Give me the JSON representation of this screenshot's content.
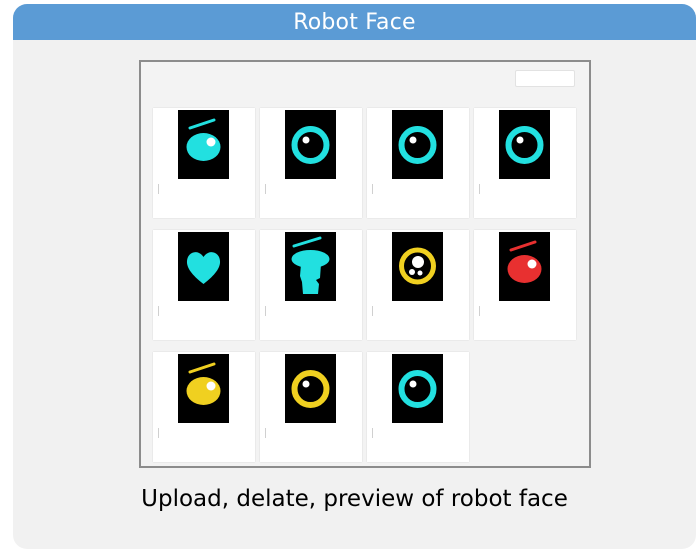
{
  "header": {
    "title": "Robot Face"
  },
  "panel": {
    "top_button_label": ""
  },
  "tile_actions": {
    "edit_label": "",
    "delete_label": ""
  },
  "faces": [
    {
      "icon": "cyan-tilted-eye-with-brow-icon",
      "color": "#22e0e0"
    },
    {
      "icon": "cyan-ring-eye-icon",
      "color": "#22e0e0"
    },
    {
      "icon": "cyan-ring-eye-icon",
      "color": "#22e0e0"
    },
    {
      "icon": "cyan-ring-eye-icon",
      "color": "#22e0e0"
    },
    {
      "icon": "cyan-heart-icon",
      "color": "#22e0e0"
    },
    {
      "icon": "cyan-mushroom-face-icon",
      "color": "#22e0e0"
    },
    {
      "icon": "yellow-ring-with-bubbles-icon",
      "color": "#f0d020"
    },
    {
      "icon": "red-eye-with-brow-icon",
      "color": "#e83030"
    },
    {
      "icon": "yellow-eye-with-brow-icon",
      "color": "#f0d020"
    },
    {
      "icon": "yellow-ring-eye-icon",
      "color": "#f0d020"
    },
    {
      "icon": "cyan-ring-eye-icon",
      "color": "#22e0e0"
    }
  ],
  "caption": "Upload, delate, preview of robot face"
}
